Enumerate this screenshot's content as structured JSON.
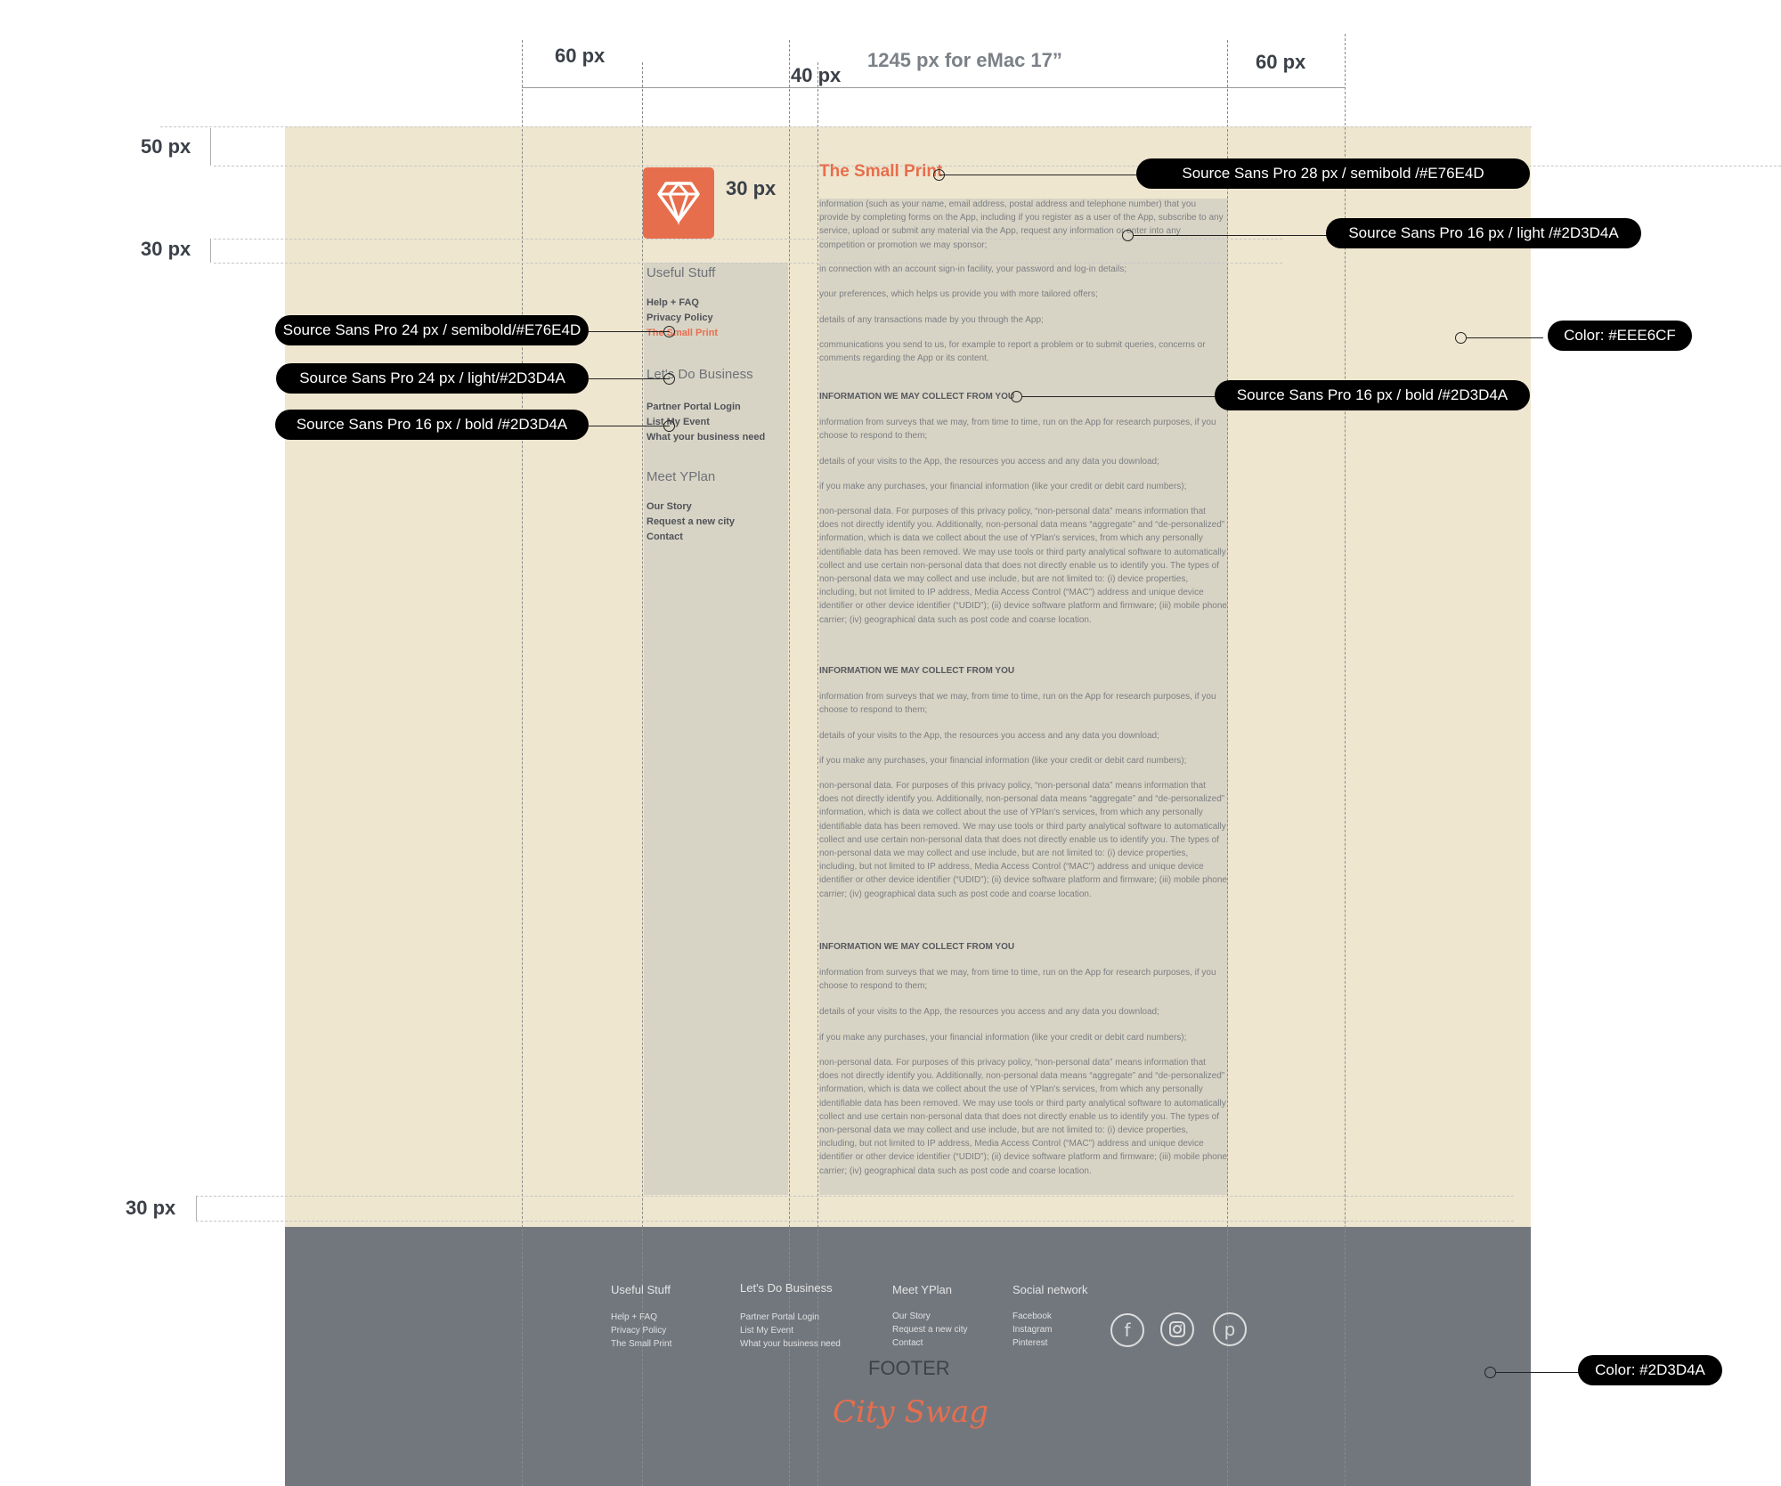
{
  "colors": {
    "accent": "#E76E4D",
    "text": "#2D3D4A",
    "page_bg": "#EEE6CF",
    "footer_bg": "#2D3D4A"
  },
  "measures": {
    "left_margin": "60 px",
    "gutter": "40 px",
    "content_width": "1245 px for eMac 17”",
    "right_margin": "60 px",
    "top_margin": "50 px",
    "logo_gap": "30 px",
    "logo_spacing": "30 px",
    "bottom_margin": "30 px"
  },
  "sidebar": {
    "sections": [
      {
        "title": "Useful Stuff",
        "links": [
          {
            "label": "Help + FAQ"
          },
          {
            "label": "Privacy Policy"
          },
          {
            "label": "The Small Print",
            "active": true
          }
        ]
      },
      {
        "title": "Let's Do Business",
        "links": [
          {
            "label": "Partner Portal Login"
          },
          {
            "label": "List My Event"
          },
          {
            "label": "What your business need"
          }
        ]
      },
      {
        "title": "Meet YPlan",
        "links": [
          {
            "label": "Our Story"
          },
          {
            "label": "Request a new city"
          },
          {
            "label": "Contact"
          }
        ]
      }
    ]
  },
  "content": {
    "title": "The Small Print",
    "intro": [
      "information (such as your name, email address, postal address and telephone number) that you provide by completing forms on the App, including if you register as a user of the App, subscribe to any service, upload or submit any material via the App, request any information or enter into any competition or promotion we may sponsor;",
      "in connection with an account sign-in facility, your password and log-in details;",
      "your preferences, which helps us provide you with more tailored offers;",
      "details of any transactions made by you through the App;",
      "communications you send to us, for example to report a problem or to submit queries, concerns or comments regarding the App or its content."
    ],
    "section_heading": "INFORMATION WE MAY COLLECT FROM YOU",
    "section_paragraphs": [
      "information from surveys that we may, from time to time, run on the App for research purposes, if you choose to respond to them;",
      "details of your visits to the App, the resources you access and any data you download;",
      "if you make any purchases, your financial information (like your credit or debit card numbers);",
      "non-personal data. For purposes of this privacy policy, “non-personal data” means information that does not directly identify you. Additionally, non-personal data means “aggregate” and “de-personalized” information, which is data we collect about the use of YPlan's services, from which any personally identifiable data has been removed. We may use tools or third party analytical software to automatically collect and use certain non-personal data that does not directly enable us to identify you. The types of non-personal data we may collect and use include, but are not limited to: (i) device properties, including, but not limited to IP address, Media Access Control (“MAC”) address and unique device identifier or other device identifier (“UDID”); (ii) device software platform and firmware; (iii) mobile phone carrier; (iv) geographical data such as post code and coarse location."
    ]
  },
  "callouts": {
    "title_font": "Source Sans Pro 28 px / semibold /#E76E4D",
    "body_font": "Source Sans Pro 16 px / light /#2D3D4A",
    "bg_color": "Color: #EEE6CF",
    "heading_font": "Source Sans Pro 16 px / bold /#2D3D4A",
    "active_link_font": "Source Sans Pro 24 px / semibold/#E76E4D",
    "section_font": "Source Sans Pro 24 px / light/#2D3D4A",
    "link_font": "Source Sans Pro 16 px / bold /#2D3D4A",
    "footer_color": "Color: #2D3D4A"
  },
  "footer": {
    "columns": [
      {
        "title": "Useful Stuff",
        "links": [
          "Help + FAQ",
          "Privacy Policy",
          "The Small Print"
        ]
      },
      {
        "title": "Let's Do Business",
        "links": [
          "Partner Portal Login",
          "List My Event",
          "What your business need"
        ]
      },
      {
        "title": "Meet YPlan",
        "links": [
          "Our Story",
          "Request a new city",
          "Contact"
        ]
      },
      {
        "title": "Social network",
        "links": [
          "Facebook",
          "Instagram",
          "Pinterest"
        ]
      }
    ],
    "social_icons": [
      "facebook-icon",
      "instagram-icon",
      "pinterest-icon"
    ],
    "label": "FOOTER",
    "brand": "City Swag"
  }
}
